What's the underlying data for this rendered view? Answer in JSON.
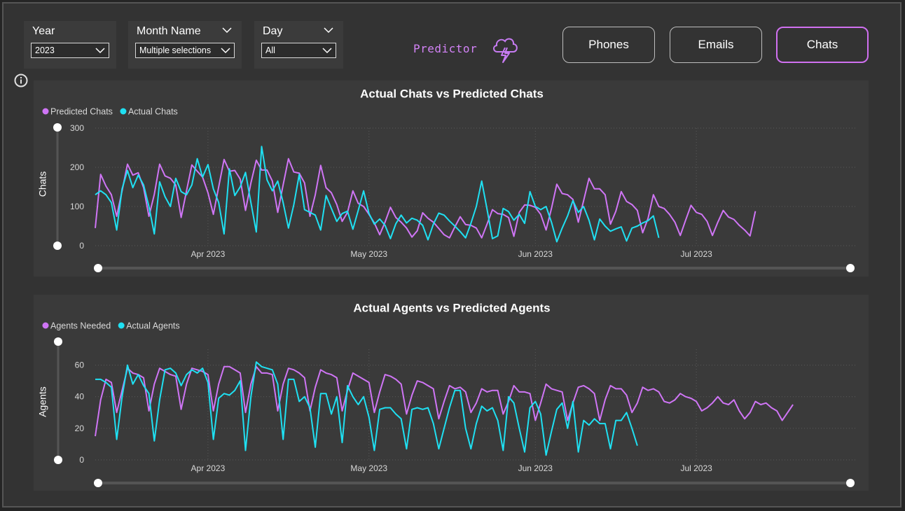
{
  "filters": {
    "year": {
      "title": "Year",
      "value": "2023"
    },
    "month": {
      "title": "Month Name",
      "value": "Multiple selections"
    },
    "day": {
      "title": "Day",
      "value": "All"
    }
  },
  "brand": {
    "label": "Predictor",
    "icon": "storm-cloud-icon"
  },
  "nav": {
    "phones": "Phones",
    "emails": "Emails",
    "chats": "Chats",
    "active": "chats"
  },
  "colors": {
    "predicted": "#cf75f5",
    "actual": "#1fe0f2",
    "active_border": "#d070f0"
  },
  "chart_data": [
    {
      "type": "line",
      "title": "Actual Chats vs Predicted Chats",
      "ylabel": "Chats",
      "xlabel": "",
      "ylim": [
        0,
        300
      ],
      "yticks": [
        0,
        100,
        200,
        300
      ],
      "xlim": [
        "2023-03-11",
        "2023-07-31"
      ],
      "xticks": [
        {
          "date": "2023-04-01",
          "label": "Apr 2023"
        },
        {
          "date": "2023-05-01",
          "label": "May 2023"
        },
        {
          "date": "2023-06-01",
          "label": "Jun 2023"
        },
        {
          "date": "2023-07-01",
          "label": "Jul 2023"
        }
      ],
      "legend_position": "top-left",
      "grid": true,
      "series": [
        {
          "name": "Predicted Chats",
          "color": "#cf75f5",
          "start": "2023-03-11",
          "values": [
            45,
            182,
            152,
            130,
            75,
            140,
            208,
            180,
            186,
            148,
            75,
            131,
            208,
            178,
            172,
            155,
            72,
            140,
            206,
            190,
            175,
            135,
            80,
            150,
            220,
            190,
            192,
            170,
            90,
            160,
            218,
            193,
            193,
            165,
            85,
            155,
            222,
            188,
            185,
            160,
            75,
            130,
            205,
            148,
            135,
            105,
            62,
            85,
            140,
            108,
            100,
            80,
            58,
            28,
            60,
            98,
            72,
            60,
            45,
            22,
            38,
            84,
            70,
            60,
            44,
            28,
            20,
            48,
            74,
            54,
            52,
            45,
            20,
            55,
            92,
            82,
            80,
            72,
            24,
            85,
            104,
            103,
            98,
            80,
            40,
            95,
            157,
            133,
            130,
            118,
            60,
            115,
            172,
            145,
            145,
            130,
            55,
            88,
            138,
            113,
            105,
            90,
            33,
            70,
            130,
            100,
            95,
            80,
            60,
            26,
            65,
            103,
            85,
            80,
            62,
            26,
            60,
            90,
            73,
            67,
            52,
            40,
            25,
            88
          ]
        },
        {
          "name": "Actual Chats",
          "color": "#1fe0f2",
          "start": "2023-03-11",
          "values": [
            130,
            140,
            130,
            110,
            40,
            145,
            192,
            148,
            180,
            155,
            100,
            30,
            163,
            125,
            100,
            172,
            138,
            130,
            155,
            222,
            175,
            207,
            145,
            110,
            30,
            196,
            128,
            150,
            187,
            110,
            35,
            253,
            168,
            140,
            165,
            110,
            45,
            105,
            182,
            92,
            85,
            78,
            40,
            128,
            95,
            62,
            82,
            88,
            42,
            90,
            140,
            82,
            55,
            68,
            52,
            18,
            56,
            78,
            58,
            70,
            65,
            52,
            15,
            55,
            83,
            78,
            63,
            50,
            36,
            20,
            57,
            100,
            165,
            93,
            18,
            25,
            95,
            87,
            65,
            80,
            57,
            138,
            100,
            92,
            100,
            60,
            10,
            45,
            76,
            115,
            85,
            100,
            65,
            15,
            68,
            50,
            37,
            43,
            48,
            12,
            45,
            50,
            58,
            64,
            76,
            20
          ]
        }
      ]
    },
    {
      "type": "line",
      "title": "Actual Agents vs Predicted Agents",
      "ylabel": "Agents",
      "xlabel": "",
      "ylim": [
        0,
        70
      ],
      "yticks": [
        0,
        20,
        40,
        60
      ],
      "xlim": [
        "2023-03-11",
        "2023-07-31"
      ],
      "xticks": [
        {
          "date": "2023-04-01",
          "label": "Apr 2023"
        },
        {
          "date": "2023-05-01",
          "label": "May 2023"
        },
        {
          "date": "2023-06-01",
          "label": "Jun 2023"
        },
        {
          "date": "2023-07-01",
          "label": "Jul 2023"
        }
      ],
      "legend_position": "top-left",
      "grid": true,
      "series": [
        {
          "name": "Agents Needed",
          "color": "#cf75f5",
          "start": "2023-03-11",
          "values": [
            15,
            38,
            51,
            49,
            30,
            44,
            58,
            55,
            54,
            52,
            31,
            48,
            58,
            56,
            54,
            53,
            32,
            48,
            58,
            57,
            56,
            54,
            31,
            48,
            59,
            59,
            57,
            55,
            30,
            48,
            59,
            55,
            55,
            54,
            31,
            48,
            58,
            57,
            55,
            52,
            31,
            46,
            57,
            55,
            54,
            52,
            31,
            44,
            55,
            53,
            51,
            49,
            30,
            43,
            54,
            53,
            51,
            48,
            29,
            41,
            50,
            49,
            47,
            45,
            26,
            37,
            47,
            45,
            46,
            43,
            30,
            36,
            45,
            43,
            44,
            44,
            29,
            37,
            47,
            43,
            43,
            42,
            25,
            36,
            48,
            45,
            44,
            43,
            25,
            36,
            46,
            47,
            45,
            42,
            25,
            38,
            47,
            45,
            45,
            41,
            30,
            36,
            46,
            44,
            45,
            43,
            37,
            36,
            38,
            42,
            40,
            39,
            37,
            31,
            33,
            36,
            40,
            36,
            35,
            38,
            31,
            26,
            30,
            37,
            35,
            36,
            33,
            31,
            25,
            30,
            35
          ]
        },
        {
          "name": "Actual Agents",
          "color": "#1fe0f2",
          "start": "2023-03-11",
          "values": [
            51,
            51,
            49,
            46,
            13,
            40,
            60,
            48,
            54,
            47,
            42,
            12,
            38,
            57,
            58,
            55,
            47,
            54,
            57,
            55,
            58,
            49,
            13,
            39,
            42,
            41,
            44,
            50,
            6,
            40,
            62,
            59,
            58,
            57,
            48,
            13,
            51,
            51,
            37,
            40,
            33,
            8,
            42,
            42,
            29,
            40,
            11,
            47,
            40,
            35,
            40,
            27,
            6,
            32,
            33,
            33,
            29,
            26,
            7,
            32,
            33,
            32,
            33,
            23,
            7,
            20,
            33,
            44,
            44,
            20,
            7,
            23,
            34,
            31,
            33,
            25,
            6,
            40,
            36,
            20,
            5,
            33,
            37,
            29,
            3,
            18,
            32,
            36,
            20,
            37,
            5,
            25,
            22,
            26,
            23,
            23,
            7,
            25,
            25,
            30,
            20,
            9
          ]
        }
      ]
    }
  ]
}
